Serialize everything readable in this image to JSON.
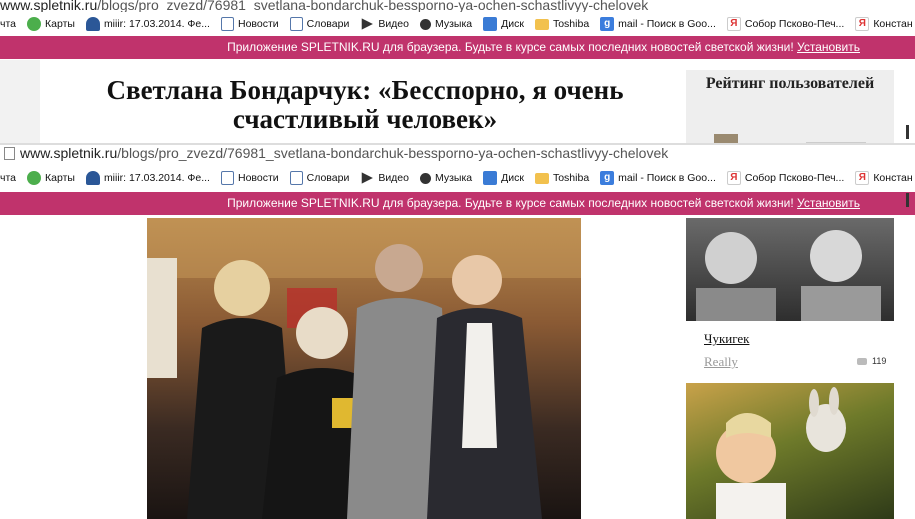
{
  "browser": {
    "url_host": "www.spletnik.ru",
    "url_path": "/blogs/pro_zvezd/76981_svetlana-bondarchuk-bessporno-ya-ochen-schastlivyy-chelovek",
    "bookmarks": [
      {
        "label": "чта",
        "icon": "none"
      },
      {
        "label": "Карты",
        "icon": "maps-icon"
      },
      {
        "label": "miiir: 17.03.2014. Фе...",
        "icon": "user-icon"
      },
      {
        "label": "Новости",
        "icon": "page-icon"
      },
      {
        "label": "Словари",
        "icon": "page-icon"
      },
      {
        "label": "Видео",
        "icon": "play-icon"
      },
      {
        "label": "Музыка",
        "icon": "music-icon"
      },
      {
        "label": "Диск",
        "icon": "disk-icon"
      },
      {
        "label": "Toshiba",
        "icon": "folder-icon"
      },
      {
        "label": "mail - Поиск в Goo...",
        "icon": "google-icon"
      },
      {
        "label": "Собор Псково-Печ...",
        "icon": "yandex-icon"
      },
      {
        "label": "Констан",
        "icon": "yandex-icon"
      }
    ]
  },
  "promo": {
    "text": "Приложение SPLETNIK.RU для браузера. Будьте в курсе самых последних новостей светской жизни!",
    "link": "Установить",
    "color": "#c0336c"
  },
  "article": {
    "title": "Светлана Бондарчук: «Бесспорно, я очень счастливый человек»"
  },
  "sidebar": {
    "rating_title": "Рейтинг пользователей",
    "item": {
      "name": "Чукигек",
      "subtitle": "Really",
      "comments": "119"
    }
  }
}
